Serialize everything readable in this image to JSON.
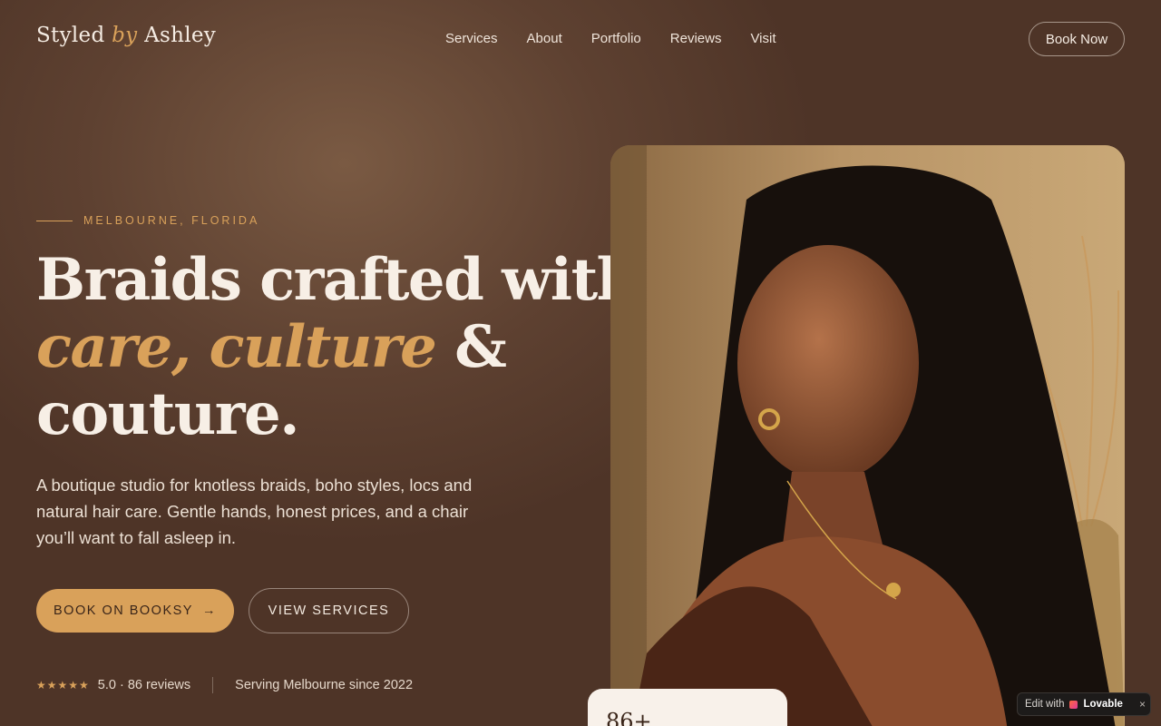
{
  "nav": {
    "logo_part1": "Styled",
    "logo_by": "by",
    "logo_part2": "Ashley",
    "links": [
      "Services",
      "About",
      "Portfolio",
      "Reviews",
      "Visit"
    ],
    "cta": "Book Now"
  },
  "hero": {
    "eyebrow": "MELBOURNE, FLORIDA",
    "headline_line1": "Braids crafted with",
    "headline_gold": "care, culture",
    "headline_amp": "&",
    "headline_line3": "couture.",
    "lede": "A boutique studio for knotless braids, boho styles, locs and natural hair care. Gentle hands, honest prices, and a chair you’ll want to fall asleep in.",
    "primary_button": "BOOK ON BOOKSY",
    "primary_arrow": "→",
    "secondary_button": "VIEW SERVICES",
    "stars": "★★★★★",
    "rating_text": "5.0 · 86 reviews",
    "serving_text": "Serving Melbourne since 2022",
    "stat_value": "86+"
  },
  "badge": {
    "edit_with": "Edit with",
    "brand": "Lovable",
    "close": "×"
  },
  "colors": {
    "accent": "#d9a15a",
    "background": "#5e4131",
    "text": "#f3e9df"
  }
}
